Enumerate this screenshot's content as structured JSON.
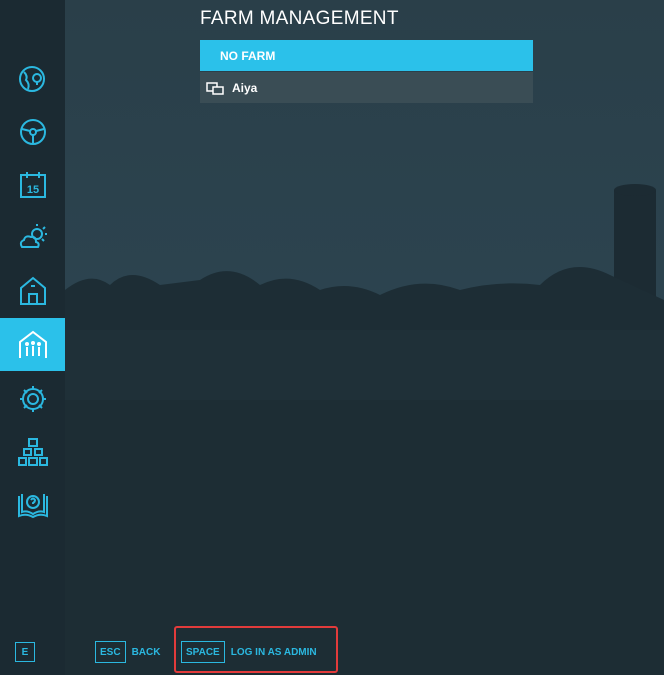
{
  "header": {
    "title": "FARM MANAGEMENT"
  },
  "farms": [
    {
      "label": "NO FARM",
      "selected": true
    },
    {
      "label": "Aiya",
      "selected": false,
      "icon": "player-monitor-icon"
    }
  ],
  "sidebar": {
    "items": [
      {
        "icon": "map-globe-icon"
      },
      {
        "icon": "steering-wheel-icon"
      },
      {
        "icon": "calendar-icon",
        "label": "15"
      },
      {
        "icon": "weather-icon"
      },
      {
        "icon": "farm-building-icon"
      },
      {
        "icon": "farm-management-icon",
        "active": true
      },
      {
        "icon": "gear-icon"
      },
      {
        "icon": "production-chain-icon"
      },
      {
        "icon": "help-book-icon"
      }
    ],
    "bottom_key": "E"
  },
  "footer": {
    "back": {
      "key": "ESC",
      "label": "BACK"
    },
    "admin": {
      "key": "SPACE",
      "label": "LOG IN AS ADMIN"
    }
  },
  "colors": {
    "accent": "#2bc1ea",
    "sidebar": "#1b2a32",
    "highlight": "#e23b3b"
  }
}
